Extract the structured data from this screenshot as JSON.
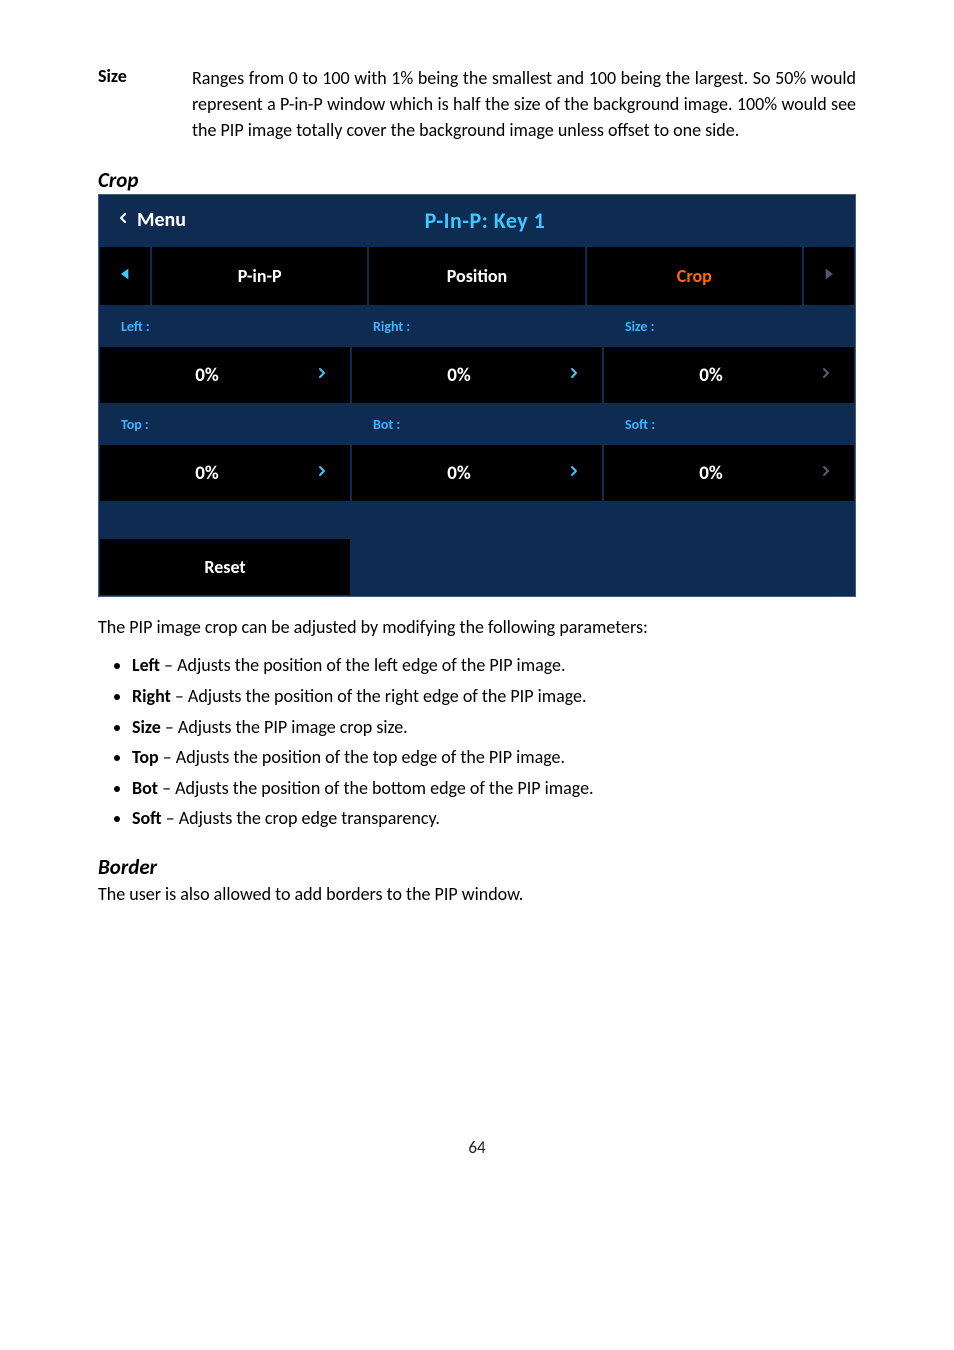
{
  "def": {
    "term": "Size",
    "desc": "Ranges from 0 to 100 with 1% being the smallest and 100 being the largest. So 50% would represent a P-in-P window which is half the size of the background image. 100% would see the PIP image totally cover the background image unless offset to one side."
  },
  "crop": {
    "heading": "Crop",
    "panel": {
      "back_label": "Menu",
      "title": "P-In-P: Key 1",
      "tabs": [
        "P-in-P",
        "Position",
        "Crop"
      ],
      "row1_labels": [
        "Left :",
        "Right :",
        "Size :"
      ],
      "row1_values": [
        "0%",
        "0%",
        "0%"
      ],
      "row2_labels": [
        "Top :",
        "Bot :",
        "Soft :"
      ],
      "row2_values": [
        "0%",
        "0%",
        "0%"
      ],
      "reset": "Reset"
    },
    "intro": "The PIP image crop can be adjusted by modifying the following parameters:",
    "bullets": [
      {
        "b": "Left",
        "t": " – Adjusts the position of the left edge of the PIP image."
      },
      {
        "b": "Right",
        "t": " – Adjusts the position of the right edge of the PIP image."
      },
      {
        "b": "Size",
        "t": " – Adjusts the PIP image crop size."
      },
      {
        "b": "Top",
        "t": " – Adjusts the position of the top edge of the PIP image."
      },
      {
        "b": "Bot",
        "t": " – Adjusts the position of the bottom edge of the PIP image."
      },
      {
        "b": "Soft",
        "t": " – Adjusts the crop edge transparency."
      }
    ]
  },
  "border": {
    "heading": "Border",
    "text": "The user is also allowed to add borders to the PIP window."
  },
  "page_number": "64"
}
